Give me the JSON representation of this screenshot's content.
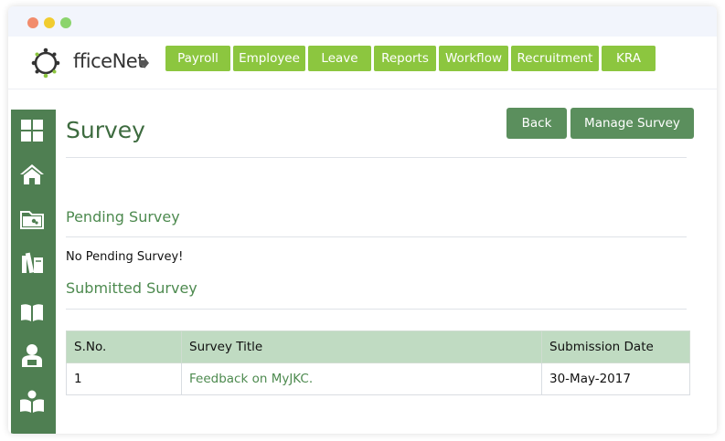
{
  "header": {
    "logo_text": "fficeNet",
    "nav": [
      {
        "label": "Payroll"
      },
      {
        "label": "Employee"
      },
      {
        "label": "Leave"
      },
      {
        "label": "Reports"
      },
      {
        "label": "Workflow"
      },
      {
        "label": "Recruitment"
      },
      {
        "label": "KRA"
      }
    ]
  },
  "sidebar": {
    "icons": [
      "grid-icon",
      "home-icon",
      "folder-icon",
      "books-icon",
      "open-book-icon",
      "person-icon",
      "reader-icon"
    ]
  },
  "actions": {
    "back_label": "Back",
    "manage_label": "Manage Survey"
  },
  "page": {
    "title": "Survey",
    "pending_title": "Pending Survey",
    "pending_notice": "No Pending Survey!",
    "submitted_title": "Submitted Survey"
  },
  "table": {
    "headers": [
      "S.No.",
      "Survey Title",
      "Submission Date"
    ],
    "rows": [
      [
        "1",
        "Feedback on MyJKC.",
        "30-May-2017"
      ]
    ]
  },
  "colors": {
    "nav_green": "#8cc63f",
    "sidebar_green": "#4f7f52",
    "button_green": "#5b8f5d",
    "table_header": "#c0dbc2",
    "title_green": "#3d6b3f"
  }
}
